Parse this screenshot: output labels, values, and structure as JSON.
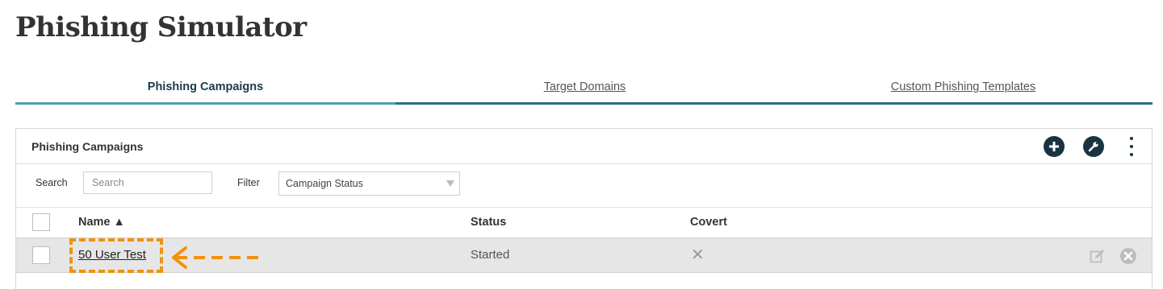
{
  "page": {
    "title": "Phishing Simulator"
  },
  "tabs": [
    {
      "label": "Phishing Campaigns",
      "active": true
    },
    {
      "label": "Target Domains",
      "active": false
    },
    {
      "label": "Custom Phishing Templates",
      "active": false
    }
  ],
  "panel": {
    "title": "Phishing Campaigns",
    "actions": [
      {
        "icon": "plus-circle-icon"
      },
      {
        "icon": "wrench-circle-icon"
      },
      {
        "icon": "kebab-menu-icon"
      }
    ]
  },
  "filters": {
    "search_label": "Search",
    "search_placeholder": "Search",
    "filter_label": "Filter",
    "filter_value": "Campaign Status"
  },
  "table": {
    "columns": {
      "name": "Name ▲",
      "status": "Status",
      "covert": "Covert"
    },
    "rows": [
      {
        "name": "50 User Test",
        "status": "Started",
        "covert": "✕"
      }
    ]
  },
  "annotation": {
    "color": "#f0920e"
  }
}
